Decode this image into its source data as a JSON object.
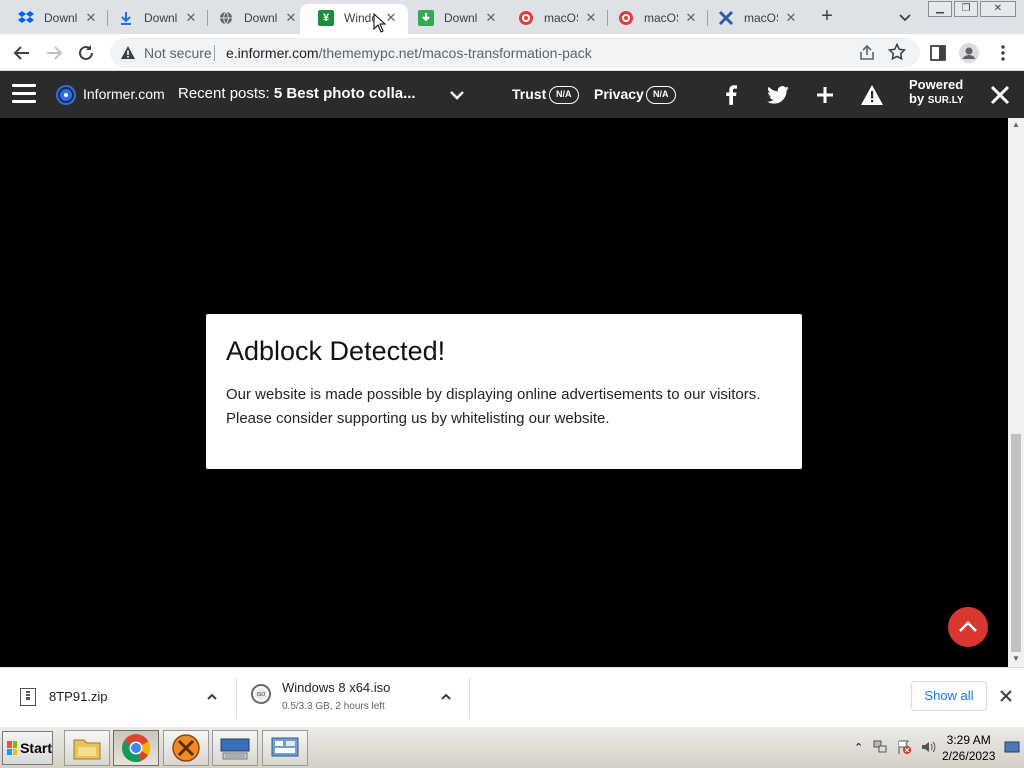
{
  "browser": {
    "tabs": [
      {
        "title": "Downl",
        "icon": "dropbox-blue-icon",
        "active": false
      },
      {
        "title": "Downl",
        "icon": "download-arrow-icon",
        "active": false
      },
      {
        "title": "Downl",
        "icon": "globe-icon",
        "active": false
      },
      {
        "title": "Windo",
        "icon": "green-shield-icon",
        "active": true
      },
      {
        "title": "Downl",
        "icon": "green-download-icon",
        "active": false
      },
      {
        "title": "macOS",
        "icon": "red-circle-icon",
        "active": false
      },
      {
        "title": "macOS",
        "icon": "red-circle-icon",
        "active": false
      },
      {
        "title": "macOS",
        "icon": "blue-x-icon",
        "active": false
      }
    ],
    "security_label": "Not secure",
    "url_host": "e.informer.com",
    "url_path": "/thememypc.net/macos-transformation-pack"
  },
  "surly_bar": {
    "site_name": "Informer.com",
    "recent_prefix": "Recent posts:",
    "recent_title": "5 Best photo colla...",
    "trust_label": "Trust",
    "trust_value": "N/A",
    "privacy_label": "Privacy",
    "privacy_value": "N/A",
    "powered_line1": "Powered",
    "powered_by": "by",
    "powered_brand": "SUR.LY"
  },
  "modal": {
    "title": "Adblock Detected!",
    "line1": "Our website is made possible by displaying online advertisements to our visitors.",
    "line2": "Please consider supporting us by whitelisting our website."
  },
  "downloads": {
    "items": [
      {
        "name": "8TP91.zip",
        "status": ""
      },
      {
        "name": "Windows 8 x64.iso",
        "status": "0.5/3.3 GB, 2 hours left"
      }
    ],
    "show_all_label": "Show all"
  },
  "taskbar": {
    "start_label": "Start",
    "time": "3:29 AM",
    "date": "2/26/2023"
  },
  "colors": {
    "surly_bar": "#2b2b2b",
    "scroll_top_button": "#d9372f",
    "link_blue": "#1a73e8"
  }
}
